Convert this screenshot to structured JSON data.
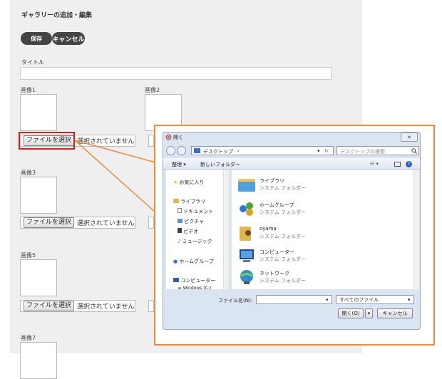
{
  "page": {
    "title": "ギャラリーの追加・編集",
    "save_label": "保存",
    "cancel_label": "キャンセル",
    "title_field_label": "タイトル",
    "image_labels": [
      "画像1",
      "画像2",
      "画像3",
      "画像5",
      "画像7"
    ],
    "file_button_label": "ファイルを選択",
    "no_file_text": "選択されていません"
  },
  "dialog": {
    "title": "開く",
    "close_label": "✕",
    "address_path": "デスクトップ",
    "search_placeholder": "デスクトップの検索",
    "toolbar": {
      "organize": "整理 ▾",
      "new_folder": "新しいフォルダー"
    },
    "nav_items": [
      {
        "label": "お気に入り",
        "icon": "star-icon"
      },
      {
        "label": "ライブラリ",
        "icon": "library-icon"
      },
      {
        "label": "ドキュメント",
        "icon": "document-icon"
      },
      {
        "label": "ピクチャ",
        "icon": "picture-icon"
      },
      {
        "label": "ビデオ",
        "icon": "video-icon"
      },
      {
        "label": "ミュージック",
        "icon": "music-icon"
      },
      {
        "label": "ホームグループ",
        "icon": "homegroup-icon"
      },
      {
        "label": "コンピューター",
        "icon": "computer-icon"
      },
      {
        "label": "Windows (C:)",
        "icon": "drive-icon"
      }
    ],
    "content_items": [
      {
        "name": "ライブラリ",
        "type": "システム フォルダー",
        "icon": "library-folder-icon"
      },
      {
        "name": "ホームグループ",
        "type": "システム フォルダー",
        "icon": "homegroup-icon"
      },
      {
        "name": "oyama",
        "type": "システム フォルダー",
        "icon": "user-folder-icon"
      },
      {
        "name": "コンピューター",
        "type": "システム フォルダー",
        "icon": "computer-icon"
      },
      {
        "name": "ネットワーク",
        "type": "システム フォルダー",
        "icon": "network-icon"
      }
    ],
    "filename_label": "ファイル名(N):",
    "filename_value": "",
    "filetype_value": "すべてのファイル",
    "open_label": "開く(O)",
    "cancel_label": "キャンセル"
  },
  "colors": {
    "callout": "#ed8a3e",
    "highlight": "#d02020",
    "dark_button": "#444444"
  }
}
